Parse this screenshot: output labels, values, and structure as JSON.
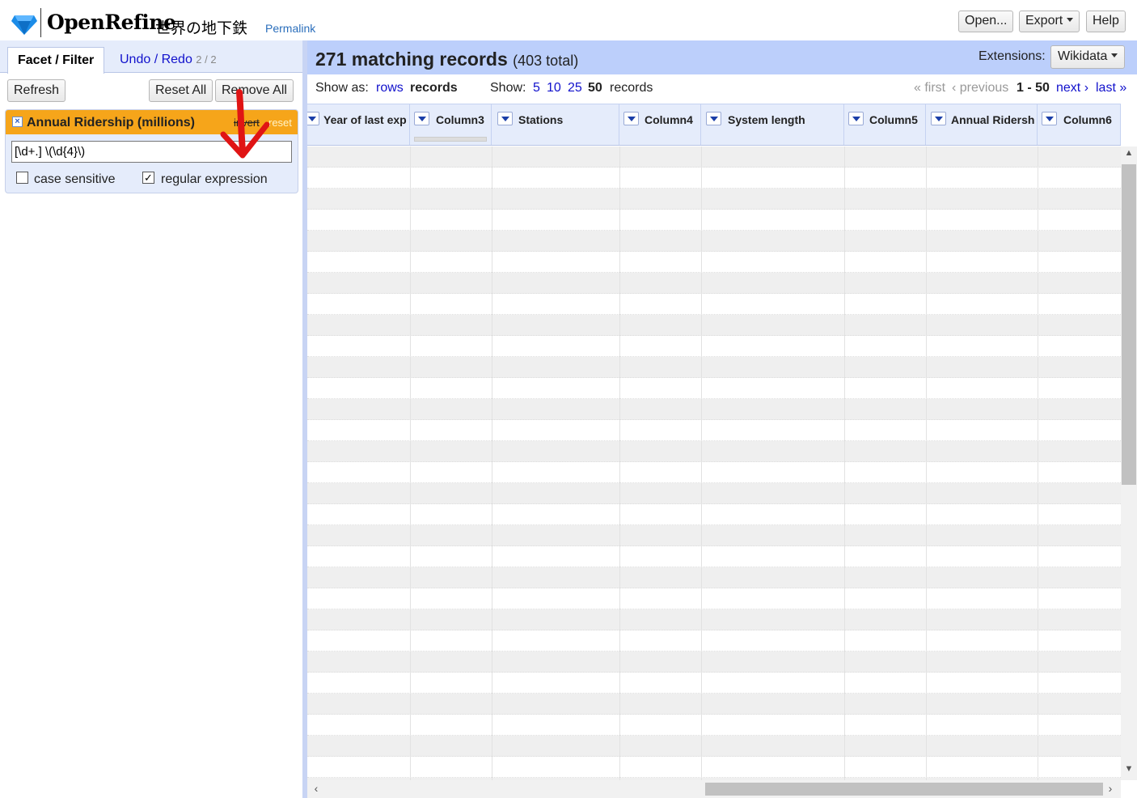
{
  "header": {
    "app_name": "OpenRefine",
    "project_name": "世界の地下鉄",
    "permalink": "Permalink",
    "buttons": {
      "open": "Open...",
      "export": "Export",
      "help": "Help"
    }
  },
  "left_panel": {
    "tabs": {
      "facet": "Facet / Filter",
      "undo": "Undo / Redo",
      "undo_count": "2 / 2"
    },
    "buttons": {
      "refresh": "Refresh",
      "reset_all": "Reset All",
      "remove_all": "Remove All"
    },
    "facet": {
      "title": "Annual Ridership (millions)",
      "invert": "invert",
      "reset": "reset",
      "query": "[\\d+.] \\(\\d{4}\\)",
      "case_sensitive_label": "case sensitive",
      "case_sensitive": false,
      "regex_label": "regular expression",
      "regex": true
    }
  },
  "summary": {
    "count": "271 matching records",
    "total": "(403 total)",
    "extensions_label": "Extensions:",
    "extensions_button": "Wikidata"
  },
  "viewbar": {
    "show_as_label": "Show as:",
    "rows": "rows",
    "records": "records",
    "show_label": "Show:",
    "sizes": [
      "5",
      "10",
      "25",
      "50"
    ],
    "selected_size": "50",
    "unit": "records",
    "first": "« first",
    "previous": "‹ previous",
    "range": "1 - 50",
    "next": "next ›",
    "last": "last »"
  },
  "columns": [
    {
      "name": "Year of last exp"
    },
    {
      "name": "Column3"
    },
    {
      "name": "Stations"
    },
    {
      "name": "Column4"
    },
    {
      "name": "System length"
    },
    {
      "name": "Column5"
    },
    {
      "name": "Annual Ridersh"
    },
    {
      "name": "Column6"
    }
  ],
  "colors": {
    "accent_blue": "#11c",
    "summary_bg": "#bccffb",
    "facet_header": "#f6a51a",
    "annotation_arrow": "#e01414"
  }
}
